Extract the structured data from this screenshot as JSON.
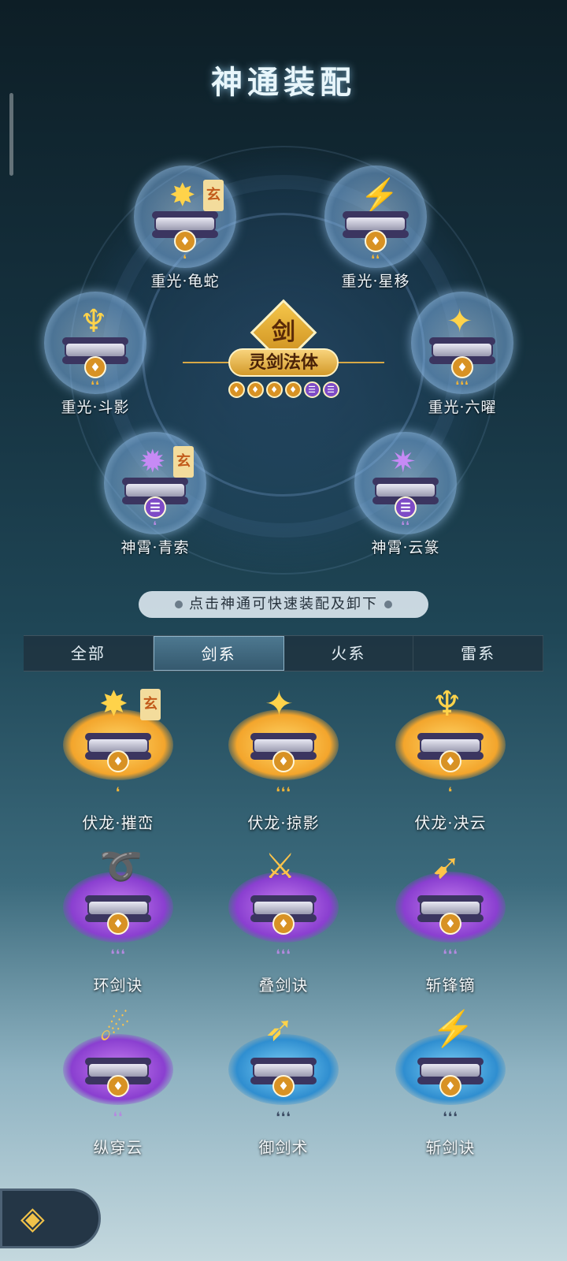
{
  "title": "神通装配",
  "center": {
    "symbol": "剑",
    "name": "灵剑法体",
    "badges": [
      "gold",
      "gold",
      "gold",
      "gold",
      "purple",
      "purple"
    ]
  },
  "wheel_slots": [
    {
      "label": "重光·龟蛇",
      "effect": "✸",
      "grade": "gold",
      "drops": "❛",
      "xuan": "玄"
    },
    {
      "label": "重光·星移",
      "effect": "⚡",
      "grade": "gold",
      "drops": "❛❛",
      "xuan": ""
    },
    {
      "label": "重光·斗影",
      "effect": "♆",
      "grade": "gold",
      "drops": "❛❛",
      "xuan": ""
    },
    {
      "label": "重光·六曜",
      "effect": "✦",
      "grade": "gold",
      "drops": "❛❛❛",
      "xuan": ""
    },
    {
      "label": "神霄·青索",
      "effect": "✹",
      "grade": "purple",
      "drops": "❛",
      "xuan": "玄"
    },
    {
      "label": "神霄·云篆",
      "effect": "✷",
      "grade": "purple",
      "drops": "❛❛",
      "xuan": ""
    }
  ],
  "hint": "点击神通可快速装配及卸下",
  "tabs": [
    {
      "label": "全部",
      "active": false
    },
    {
      "label": "剑系",
      "active": true
    },
    {
      "label": "火系",
      "active": false
    },
    {
      "label": "雷系",
      "active": false
    }
  ],
  "skills": [
    {
      "label": "伏龙·摧峦",
      "aura": "gold",
      "drops": "❛",
      "drop_color": "gold",
      "effect": "✸",
      "xuan": "玄"
    },
    {
      "label": "伏龙·掠影",
      "aura": "gold",
      "drops": "❛❛❛",
      "drop_color": "gold",
      "effect": "✦",
      "xuan": ""
    },
    {
      "label": "伏龙·决云",
      "aura": "gold",
      "drops": "❛",
      "drop_color": "gold",
      "effect": "♆",
      "xuan": ""
    },
    {
      "label": "环剑诀",
      "aura": "purple",
      "drops": "❛❛❛",
      "drop_color": "purple",
      "effect": "➰",
      "xuan": ""
    },
    {
      "label": "叠剑诀",
      "aura": "purple",
      "drops": "❛❛❛",
      "drop_color": "purple",
      "effect": "⚔",
      "xuan": ""
    },
    {
      "label": "斩锋镝",
      "aura": "purple",
      "drops": "❛❛❛",
      "drop_color": "purple",
      "effect": "➹",
      "xuan": ""
    },
    {
      "label": "纵穿云",
      "aura": "purple",
      "drops": "❛❛",
      "drop_color": "purple",
      "effect": "☄",
      "xuan": ""
    },
    {
      "label": "御剑术",
      "aura": "blue",
      "drops": "❛❛❛",
      "drop_color": "dark",
      "effect": "➶",
      "xuan": ""
    },
    {
      "label": "斩剑诀",
      "aura": "blue",
      "drops": "❛❛❛",
      "drop_color": "dark",
      "effect": "⚡",
      "xuan": ""
    }
  ],
  "colors": {
    "gold": "#d89224",
    "purple": "#7e4bc6",
    "blue": "#2f8ed0"
  }
}
